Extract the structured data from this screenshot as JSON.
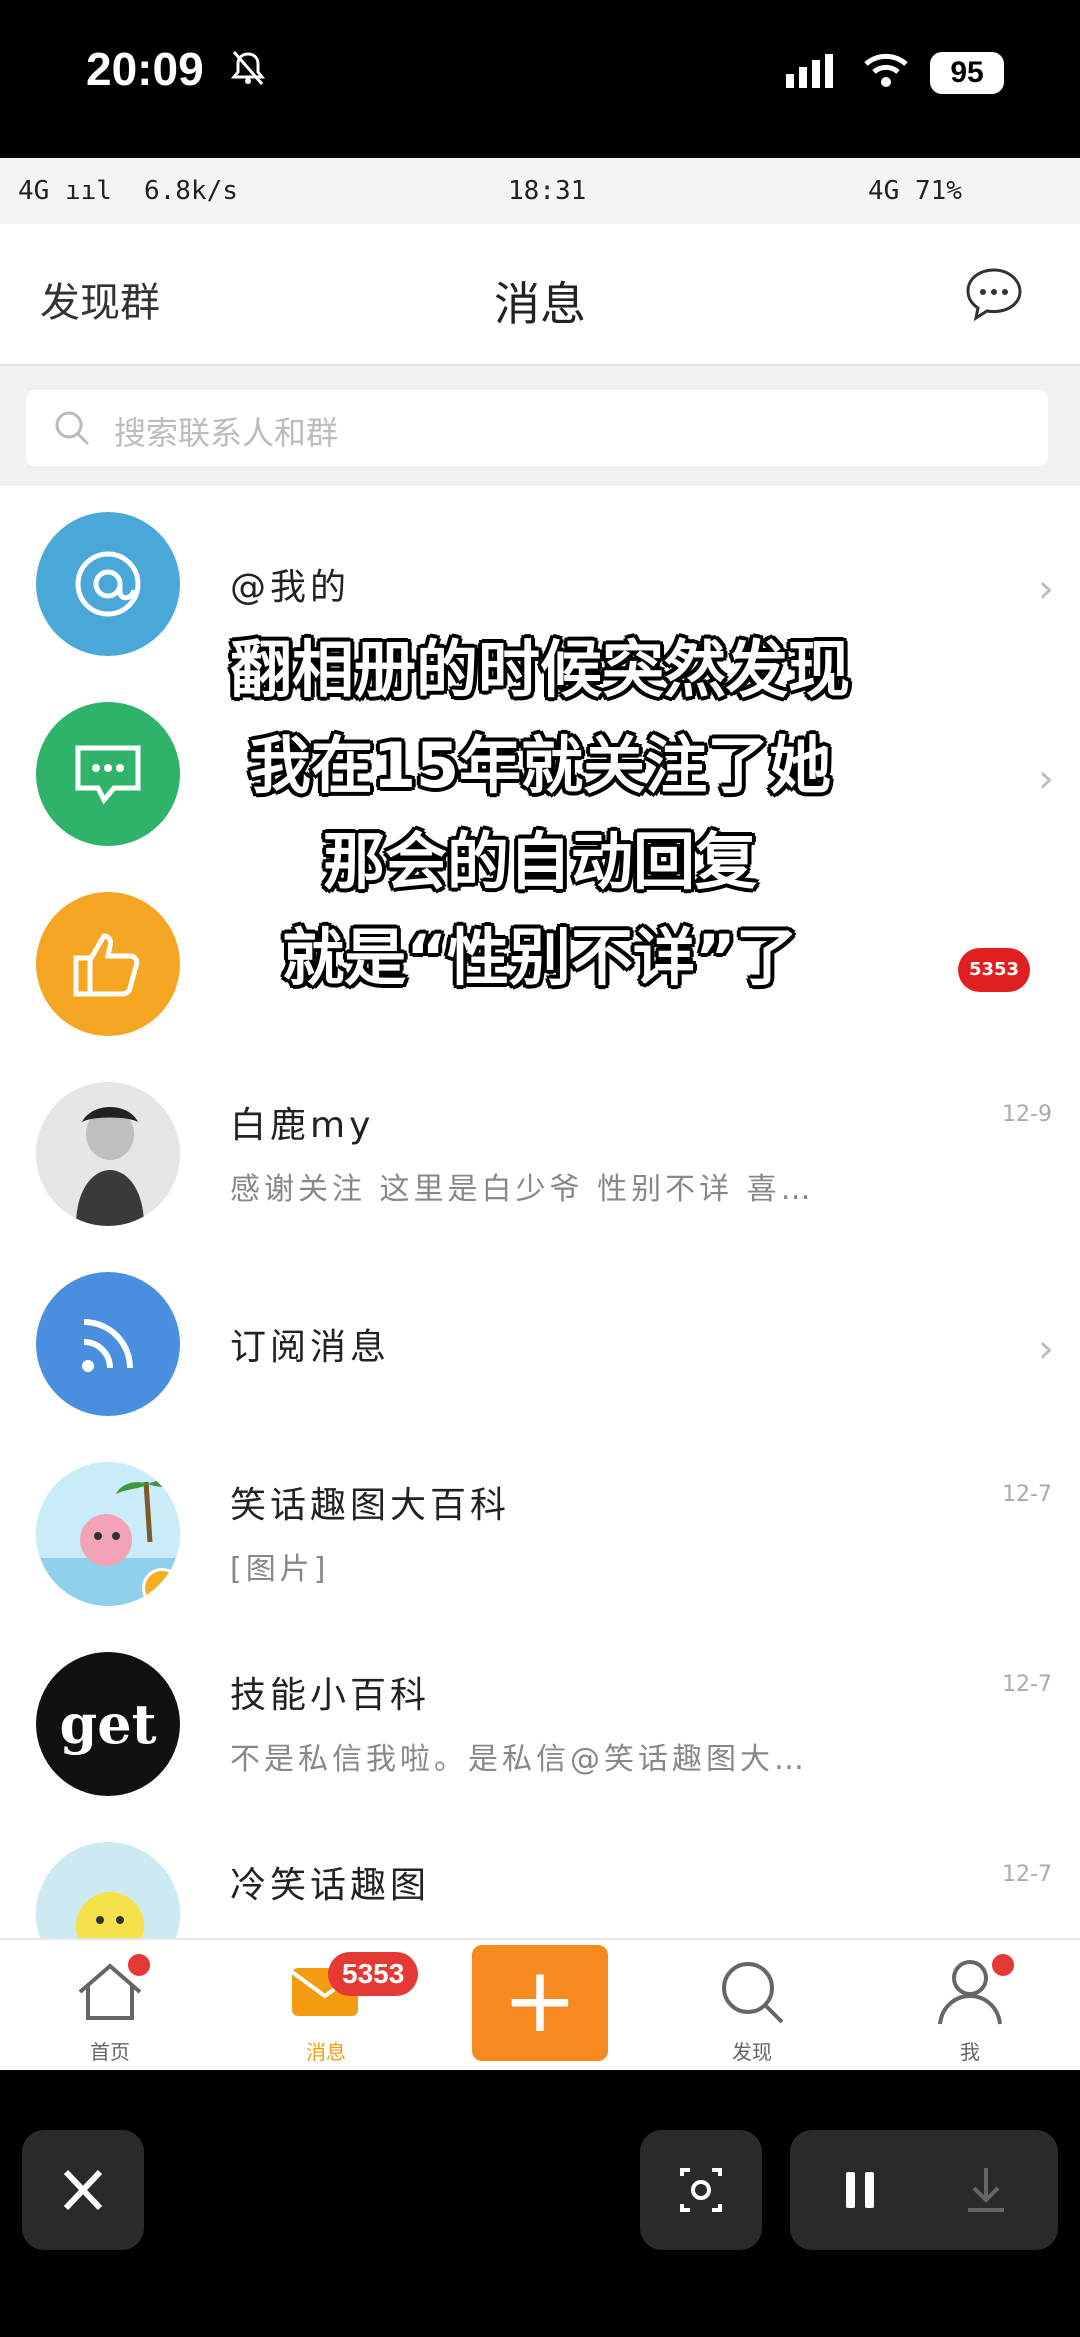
{
  "os_status": {
    "time": "20:09",
    "battery": "95"
  },
  "phone_status": {
    "left": "4G ııl",
    "speed": "6.8k/s",
    "time": "18:31",
    "right": "4G 71%"
  },
  "header": {
    "left_link": "发现群",
    "title": "消息"
  },
  "search": {
    "placeholder": "搜索联系人和群"
  },
  "rows": [
    {
      "title": "@我的",
      "subtitle": "",
      "time": "",
      "chevron": "›",
      "avatar_color": "#4aa8d8"
    },
    {
      "title": "",
      "subtitle": "",
      "time": "",
      "chevron": "›",
      "avatar_color": "#2fb36b"
    },
    {
      "title": "",
      "subtitle": "",
      "time": "",
      "badge": "5353",
      "avatar_color": "#f5a623"
    },
    {
      "title": "白鹿my",
      "subtitle": "感谢关注 这里是白少爷 性别不详 喜…",
      "time": "12-9"
    },
    {
      "title": "订阅消息",
      "subtitle": "",
      "time": "",
      "chevron": "›",
      "avatar_color": "#4a8ee0"
    },
    {
      "title": "笑话趣图大百科",
      "subtitle": "[图片]",
      "time": "12-7"
    },
    {
      "title": "技能小百科",
      "subtitle": "不是私信我啦。是私信@笑话趣图大…",
      "time": "12-7",
      "avatar_text": "get"
    },
    {
      "title": "冷笑话趣图",
      "subtitle": "",
      "time": "12-7"
    }
  ],
  "caption": {
    "line1": "翻相册的时候突然发现",
    "line2": "我在15年就关注了她",
    "line3": "那会的自动回复",
    "line4": "就是“性别不详”了"
  },
  "nav": {
    "home": "首页",
    "messages": "消息",
    "messages_badge": "5353",
    "plus": "+",
    "discover": "发现",
    "me": "我"
  },
  "colors": {
    "accent": "#f68a1e",
    "badge": "#e53935"
  },
  "icons": [
    "bell-off-icon",
    "signal-icon",
    "wifi-icon",
    "chat-bubble-icon",
    "search-icon",
    "close-icon",
    "screenshot-icon",
    "pause-icon",
    "download-icon"
  ]
}
